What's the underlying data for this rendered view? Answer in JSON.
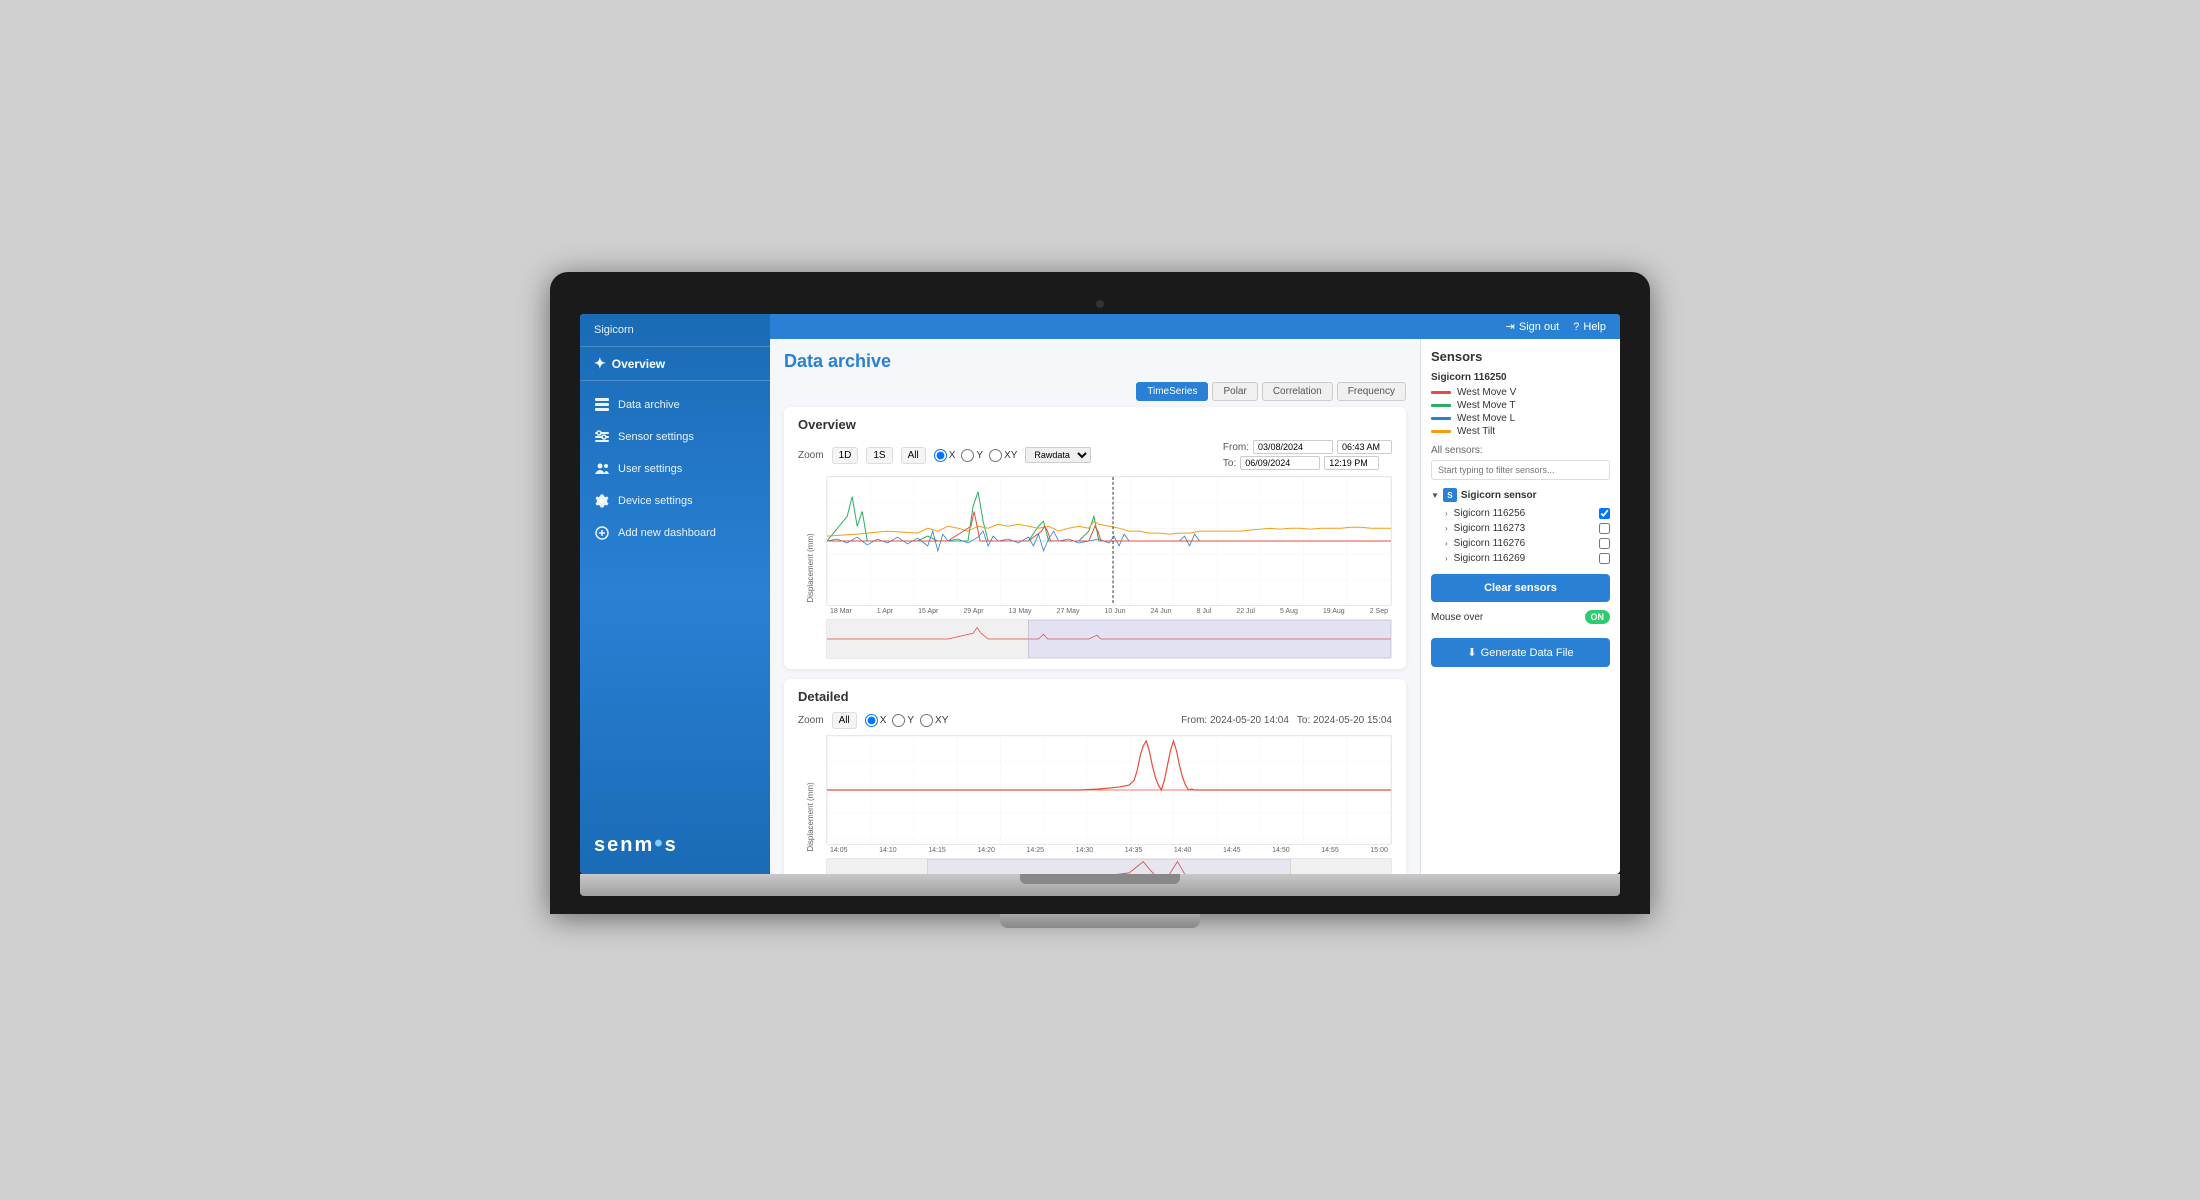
{
  "app": {
    "name": "Sigicorn",
    "signout_label": "Sign out",
    "help_label": "Help"
  },
  "sidebar": {
    "header": "Sigicorn",
    "overview_label": "Overview",
    "nav_items": [
      {
        "label": "Data archive",
        "icon": "table-icon"
      },
      {
        "label": "Sensor settings",
        "icon": "sliders-icon"
      },
      {
        "label": "User settings",
        "icon": "users-icon"
      },
      {
        "label": "Device settings",
        "icon": "gear-icon"
      },
      {
        "label": "Add new dashboard",
        "icon": "plus-icon"
      }
    ],
    "logo": "senm•s"
  },
  "page": {
    "title": "Data archive",
    "tabs": [
      "TimeSeries",
      "Polar",
      "Correlation",
      "Frequency"
    ]
  },
  "overview_chart": {
    "title": "Overview",
    "zoom_label": "Zoom",
    "zoom_options": [
      "1D",
      "1S",
      "All"
    ],
    "radio_options": [
      "X",
      "Y",
      "XY"
    ],
    "selected_radio": "X",
    "dropdown_label": "Rawdata",
    "from_label": "From:",
    "from_date": "03/08/2024",
    "from_time": "06:43 AM",
    "to_label": "To:",
    "to_date": "06/09/2024",
    "to_time": "12:19 PM",
    "x_labels": [
      "18 Mar",
      "1 Apr",
      "15 Apr",
      "29 Apr",
      "13 May",
      "27 May",
      "10 Jun",
      "24 Jun",
      "8 Jul",
      "22 Jul",
      "5 Aug",
      "19 Aug",
      "2 Sep"
    ]
  },
  "detailed_chart": {
    "title": "Detailed",
    "zoom_label": "Zoom",
    "zoom_options": [
      "All"
    ],
    "radio_options": [
      "X",
      "Y",
      "XY"
    ],
    "selected_radio": "X",
    "from_label": "From: 2024-05-20 14:04",
    "to_label": "To: 2024-05-20 15:04",
    "x_labels": [
      "14:05",
      "14:10",
      "14:15",
      "14:20",
      "14:25",
      "14:30",
      "14:35",
      "14:40",
      "14:45",
      "14:50",
      "14:55",
      "15:00"
    ]
  },
  "sensors": {
    "title": "Sensors",
    "main_sensor": "Sigicorn 116250",
    "legend": [
      {
        "label": "West Move V",
        "color": "#e74c3c"
      },
      {
        "label": "West Move T",
        "color": "#27ae60"
      },
      {
        "label": "West Move L",
        "color": "#2980d4"
      },
      {
        "label": "West Tilt",
        "color": "#f39c12"
      }
    ],
    "all_sensors_label": "All sensors:",
    "filter_placeholder": "Start typing to filter sensors...",
    "group_label": "Sigicorn sensor",
    "sensor_list": [
      {
        "label": "Sigicorn 116256",
        "checked": true
      },
      {
        "label": "Sigicorn 116273",
        "checked": false
      },
      {
        "label": "Sigicorn 116276",
        "checked": false
      },
      {
        "label": "Sigicorn 116269",
        "checked": false
      }
    ],
    "clear_btn_label": "Clear sensors",
    "mouse_over_label": "Mouse over",
    "mouse_over_state": "ON",
    "generate_btn_label": "Generate Data File"
  }
}
